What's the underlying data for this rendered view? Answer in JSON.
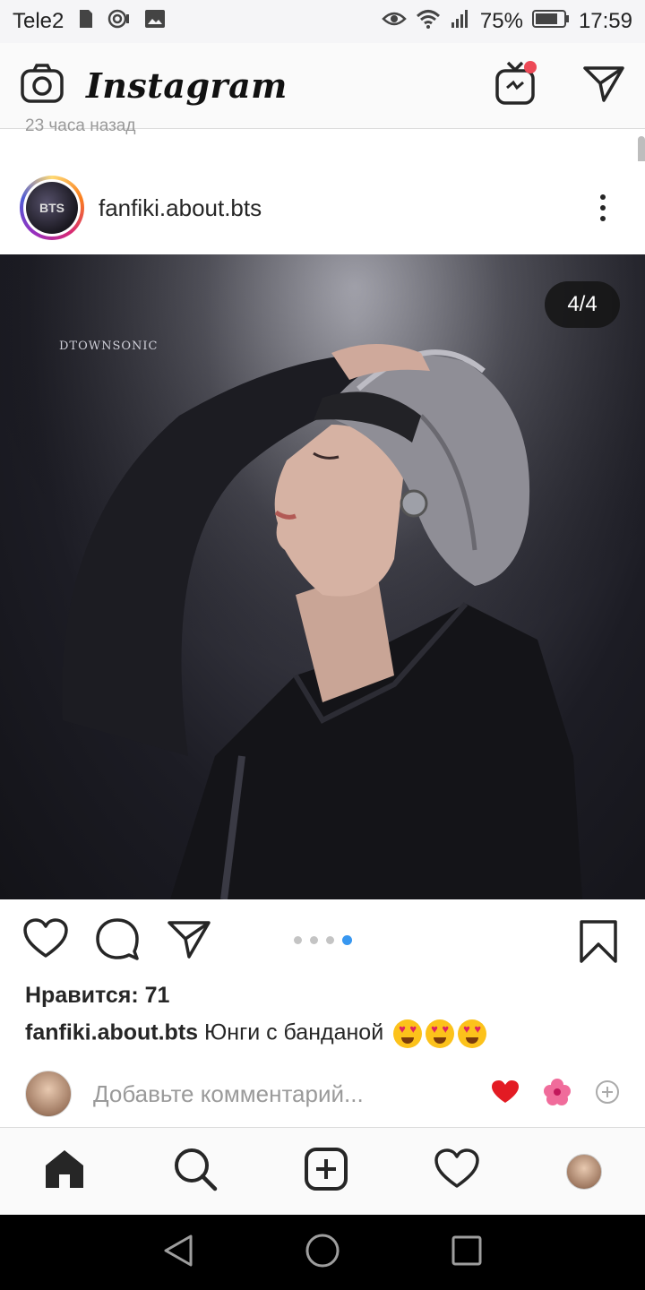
{
  "status_bar": {
    "carrier": "Tele2",
    "battery": "75%",
    "time": "17:59"
  },
  "header": {
    "logo": "Instagram"
  },
  "peek_text": "23 часа назад",
  "post": {
    "username": "fanfiki.about.bts",
    "avatar_text": "BTS",
    "counter": "4/4",
    "watermark": "DTOWNSONIC",
    "carousel_index": 4,
    "carousel_total": 4,
    "likes": "Нравится: 71",
    "caption_user": "fanfiki.about.bts",
    "caption_text": "Юнги с банданой",
    "caption_emojis": [
      "heart-eyes",
      "heart-eyes",
      "heart-eyes"
    ]
  },
  "comment": {
    "placeholder": "Добавьте комментарий...",
    "quick_reactions": [
      "red-heart",
      "hibiscus",
      "plus"
    ]
  },
  "bottom_nav": [
    "home",
    "search",
    "new-post",
    "activity",
    "profile"
  ],
  "colors": {
    "accent_blue": "#3897f0",
    "notification_red": "#ed4956",
    "text_primary": "#262626",
    "text_secondary": "#9a9a9a"
  }
}
